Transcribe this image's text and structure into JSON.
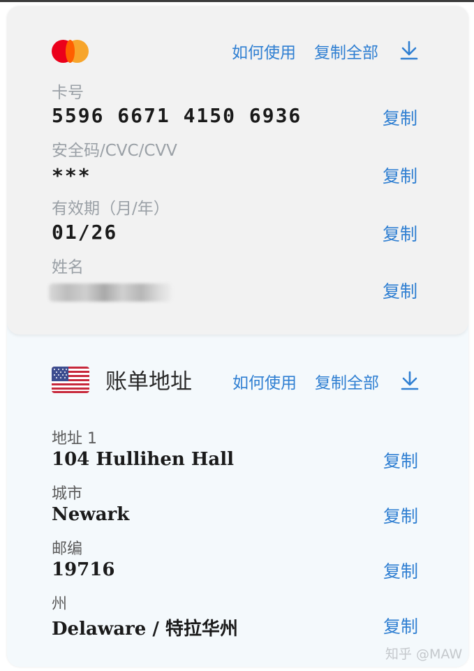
{
  "card": {
    "brand_icon": "mastercard-logo",
    "actions": {
      "how_to_use": "如何使用",
      "copy_all": "复制全部",
      "download_icon": "download-icon"
    },
    "fields": [
      {
        "label": "卡号",
        "value": "5596 6671 4150 6936",
        "copy": "复制"
      },
      {
        "label": "安全码/CVC/CVV",
        "value": "***",
        "copy": "复制"
      },
      {
        "label": "有效期（月/年）",
        "value": "01/26",
        "copy": "复制"
      },
      {
        "label": "姓名",
        "value": "",
        "copy": "复制"
      }
    ]
  },
  "billing": {
    "flag_icon": "us-flag-icon",
    "title": "账单地址",
    "actions": {
      "how_to_use": "如何使用",
      "copy_all": "复制全部",
      "download_icon": "download-icon"
    },
    "fields": [
      {
        "label": "地址 1",
        "value": "104 Hullihen Hall",
        "copy": "复制"
      },
      {
        "label": "城市",
        "value": "Newark",
        "copy": "复制"
      },
      {
        "label": "邮编",
        "value": "19716",
        "copy": "复制"
      },
      {
        "label": "州",
        "value": "Delaware / 特拉华州",
        "copy": "复制"
      }
    ]
  },
  "watermark": "知乎 @MAW",
  "colors": {
    "link": "#2f7fd2",
    "card_bg": "#f2f2f2",
    "billing_bg": "#f4f9fc"
  }
}
